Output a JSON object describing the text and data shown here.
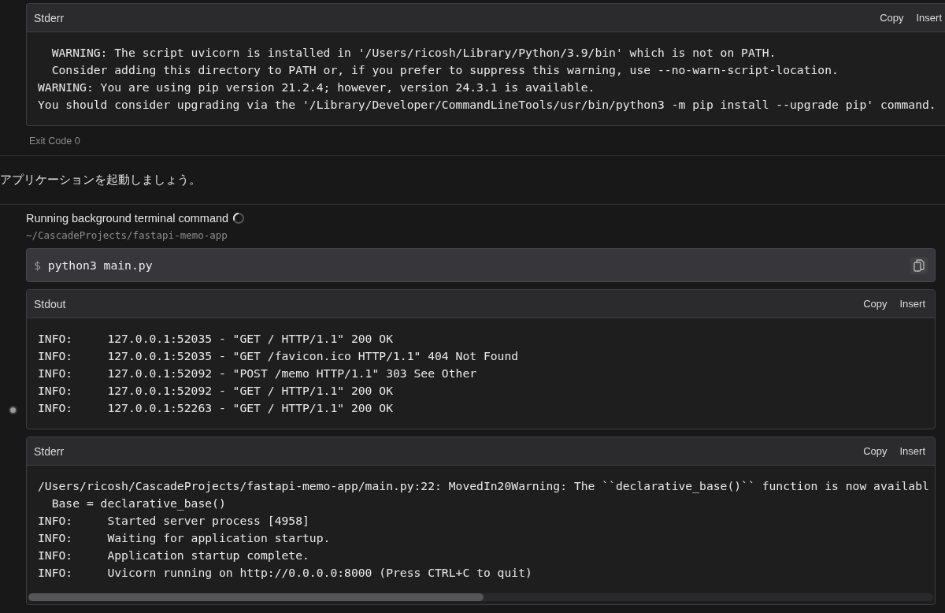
{
  "top_output": {
    "title": "Stderr",
    "actions": [
      "Copy",
      "Insert"
    ],
    "scrollable": false,
    "lines": [
      "  WARNING: The script uvicorn is installed in '/Users/ricosh/Library/Python/3.9/bin' which is not on PATH.",
      "  Consider adding this directory to PATH or, if you prefer to suppress this warning, use --no-warn-script-location.",
      "WARNING: You are using pip version 21.2.4; however, version 24.3.1 is available.",
      "You should consider upgrading via the '/Library/Developer/CommandLineTools/usr/bin/python3 -m pip install --upgrade pip' command."
    ]
  },
  "exit_code": "Exit Code 0",
  "message": "アプリケーションを起動しましょう。",
  "terminal_step": {
    "status": "Running background terminal command",
    "running": true,
    "cwd": "~/CascadeProjects/fastapi-memo-app",
    "command": {
      "prompt": "$",
      "text": "python3 main.py"
    },
    "outputs": [
      {
        "title": "Stdout",
        "actions": [
          "Copy",
          "Insert"
        ],
        "scrollable": false,
        "lines": [
          "INFO:     127.0.0.1:52035 - \"GET / HTTP/1.1\" 200 OK",
          "INFO:     127.0.0.1:52035 - \"GET /favicon.ico HTTP/1.1\" 404 Not Found",
          "INFO:     127.0.0.1:52092 - \"POST /memo HTTP/1.1\" 303 See Other",
          "INFO:     127.0.0.1:52092 - \"GET / HTTP/1.1\" 200 OK",
          "INFO:     127.0.0.1:52263 - \"GET / HTTP/1.1\" 200 OK"
        ]
      },
      {
        "title": "Stderr",
        "actions": [
          "Copy",
          "Insert"
        ],
        "scrollable": true,
        "lines": [
          "/Users/ricosh/CascadeProjects/fastapi-memo-app/main.py:22: MovedIn20Warning: The ``declarative_base()`` function is now availabl",
          "  Base = declarative_base()",
          "INFO:     Started server process [4958]",
          "INFO:     Waiting for application startup.",
          "INFO:     Application startup complete.",
          "INFO:     Uvicorn running on http://0.0.0.0:8000 (Press CTRL+C to quit)"
        ]
      }
    ]
  }
}
